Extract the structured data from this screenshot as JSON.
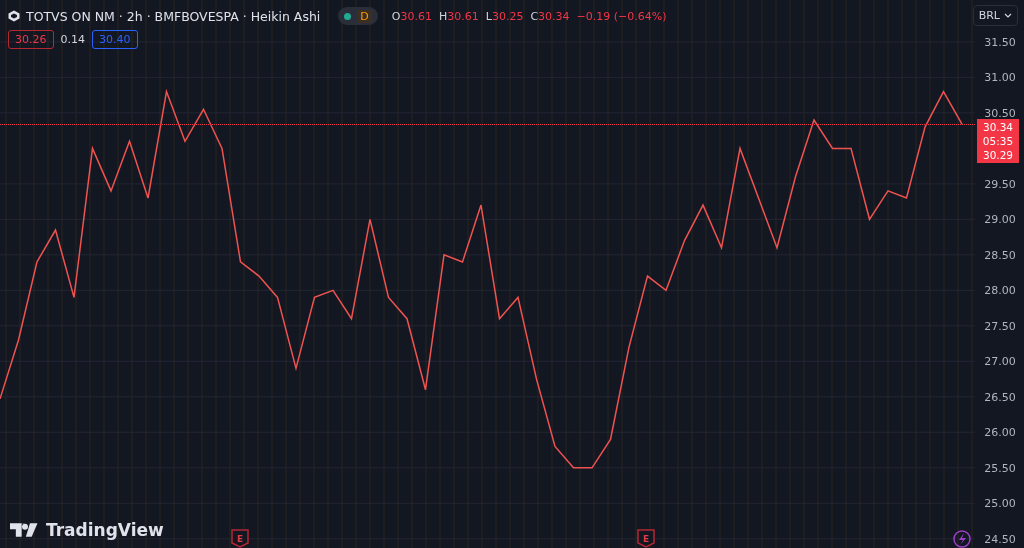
{
  "header": {
    "symbol": "TOTVS ON NM · 2h · BMFBOVESPA · Heikin Ashi",
    "market_badge": "D",
    "ohlc": [
      {
        "label": "O",
        "value": "30.61"
      },
      {
        "label": "H",
        "value": "30.61"
      },
      {
        "label": "L",
        "value": "30.25"
      },
      {
        "label": "C",
        "value": "30.34"
      }
    ],
    "change": "−0.19 (−0.64%)"
  },
  "quote": {
    "bid": "30.26",
    "spread": "0.14",
    "ask": "30.40"
  },
  "currency": "BRL",
  "price_label": {
    "price": "30.34",
    "countdown": "05:35",
    "previous": "30.29"
  },
  "chart_data": {
    "type": "line",
    "ylim": [
      24.37,
      32.09
    ],
    "grid": true,
    "yticks": [
      {
        "value": 31.5,
        "label": "31.50"
      },
      {
        "value": 31,
        "label": "31.00"
      },
      {
        "value": 30.5,
        "label": "30.50"
      },
      {
        "value": 29.5,
        "label": "29.50"
      },
      {
        "value": 29,
        "label": "29.00"
      },
      {
        "value": 28.5,
        "label": "28.50"
      },
      {
        "value": 28,
        "label": "28.00"
      },
      {
        "value": 27.5,
        "label": "27.50"
      },
      {
        "value": 27,
        "label": "27.00"
      },
      {
        "value": 26.5,
        "label": "26.50"
      },
      {
        "value": 26,
        "label": "26.00"
      },
      {
        "value": 25.5,
        "label": "25.50"
      },
      {
        "value": 25,
        "label": "25.00"
      },
      {
        "value": 24.5,
        "label": "24.50"
      }
    ],
    "series": [
      {
        "color": "#ef5350",
        "values": [
          26.47,
          27.3,
          28.4,
          28.85,
          27.9,
          30.0,
          29.4,
          30.1,
          29.3,
          30.8,
          30.1,
          30.55,
          30.0,
          28.4,
          28.2,
          27.9,
          26.9,
          27.9,
          28.0,
          27.6,
          29.0,
          27.9,
          27.6,
          26.6,
          28.5,
          28.4,
          29.2,
          27.6,
          27.9,
          26.75,
          25.8,
          25.5,
          25.5,
          25.9,
          27.2,
          28.2,
          28.0,
          28.7,
          29.2,
          28.6,
          30.0,
          29.3,
          28.6,
          29.6,
          30.4,
          30.0,
          30.0,
          29.0,
          29.4,
          29.3,
          30.3,
          30.8,
          30.34
        ]
      }
    ],
    "annotations": [
      {
        "text": "E"
      },
      {
        "text": "E"
      }
    ]
  },
  "logo": "TradingView"
}
